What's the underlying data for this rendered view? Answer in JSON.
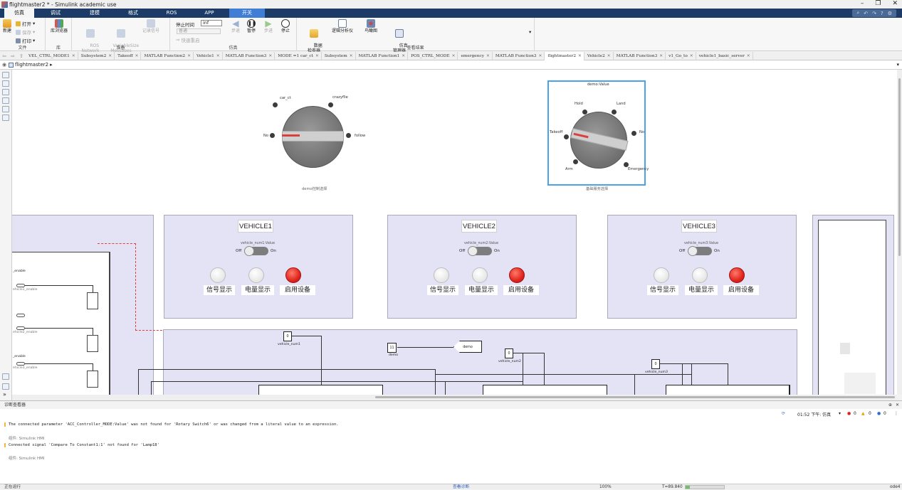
{
  "window": {
    "title": "flightmaster2 * - Simulink academic use"
  },
  "ribbon_tabs": [
    "仿真",
    "调试",
    "建模",
    "格式",
    "ROS",
    "APP",
    "开关"
  ],
  "ribbon": {
    "file": {
      "new": "新建",
      "open": "打开",
      "save": "保存",
      "print": "打印",
      "label": "文件"
    },
    "library": {
      "browser": "库浏览器",
      "label": "库"
    },
    "prepare": {
      "ros_network": "ROS\nNetwork",
      "variable_size": "VariableSize\nMessages",
      "log_signal": "记录信号",
      "label": "准备"
    },
    "simulate": {
      "stop_time_label": "停止时间",
      "stop_time_value": "inf",
      "mode_value": "普通",
      "fast_restart": "快速重启",
      "step_back": "步退",
      "pause": "暂停",
      "step_forward": "步进",
      "stop": "停止",
      "label": "仿真"
    },
    "review": {
      "data_inspector": "数据\n检查器",
      "logic_analyzer": "逻辑分析仪",
      "bird_eye": "鸟瞰图",
      "sim_manager": "仿真\n管理器",
      "label": "查看结果"
    }
  },
  "model_tabs": [
    "VEL_CTRL_MODE1",
    "Subsystem2",
    "Takeoff",
    "MATLAB Function2",
    "Vehicle1",
    "MATLAB Function3",
    "MODE =1 car_ct",
    "Subsystem",
    "MATLAB Function1",
    "POS_CTRL_MODE",
    "emergency",
    "MATLAB Function3",
    "flightmaster2",
    "Vehicle2",
    "MATLAB Function3",
    "v1_Go_to",
    "vehicle1_basic_server"
  ],
  "active_tab": "flightmaster2",
  "breadcrumb": "flightmaster2",
  "knob1": {
    "labels": {
      "top_left": "car_ct",
      "top_right": "crazyflie",
      "left": "No",
      "right": "follow"
    },
    "caption": "demo控制选择"
  },
  "knob2": {
    "title": "demo:Value",
    "labels": {
      "hold": "Hold",
      "land": "Land",
      "takeoff": "Takeoff",
      "no": "No",
      "arm": "Arm",
      "emergency": "Emergency"
    },
    "caption": "基础服务选择"
  },
  "vehicles": [
    {
      "title": "VEHICLE1",
      "toggle_caption": "vehicle_num1:Value",
      "off": "Off",
      "on": "On",
      "buttons": [
        "信号显示",
        "电量显示",
        "启用设备"
      ]
    },
    {
      "title": "VEHICLE2",
      "toggle_caption": "vehicle_num2:Value",
      "off": "Off",
      "on": "On",
      "buttons": [
        "信号显示",
        "电量显示",
        "启用设备"
      ]
    },
    {
      "title": "VEHICLE3",
      "toggle_caption": "vehicle_num3:Value",
      "off": "Off",
      "on": "On",
      "buttons": [
        "信号显示",
        "电量显示",
        "启用设备"
      ]
    }
  ],
  "left_blocks": {
    "enable_a": "_enable",
    "enable_a_sub": "ehicle1_enable",
    "enable_b_sub": "ehicle2_enable",
    "enable_c": "_enable",
    "enable_c_sub": "ehicle3_enable"
  },
  "blocks": {
    "vn1": {
      "value": "0",
      "label": "vehicle_num1"
    },
    "demo_const": {
      "value": "11",
      "label": "demo"
    },
    "demo_goto": {
      "value": "demo"
    },
    "vn2": {
      "value": "0",
      "label": "vehicle_num2"
    },
    "vn3": {
      "value": "0",
      "label": "vehicle_num3"
    }
  },
  "diagnostics": {
    "title": "诊断查看器",
    "time": "01:52 下午: 仿真",
    "errors": "0",
    "warnings": "0",
    "infos": "0",
    "messages": [
      {
        "text": "The connected parameter 'ACC_Controller_MODE:Value' was not found for 'Rotary Switch6' or was changed from a literal value to an expression.",
        "component": "组件: Simulink HMI"
      },
      {
        "text": "Connected signal 'Compare To Constant1:1' not found for 'Lamp18'",
        "component": "组件: Simulink HMI"
      }
    ]
  },
  "status": {
    "left": "正在运行",
    "center": "查看诊断",
    "zoom": "100%",
    "time": "T=89.840",
    "progress": 0.12,
    "solver": "ode4"
  },
  "colors": {
    "ribbon_bg": "#1c3b66",
    "contextual_tab": "#3f7ed4",
    "panel_bg": "#e4e3f6",
    "lamp_red": "#e0261e",
    "selection": "#4aa3e8"
  }
}
